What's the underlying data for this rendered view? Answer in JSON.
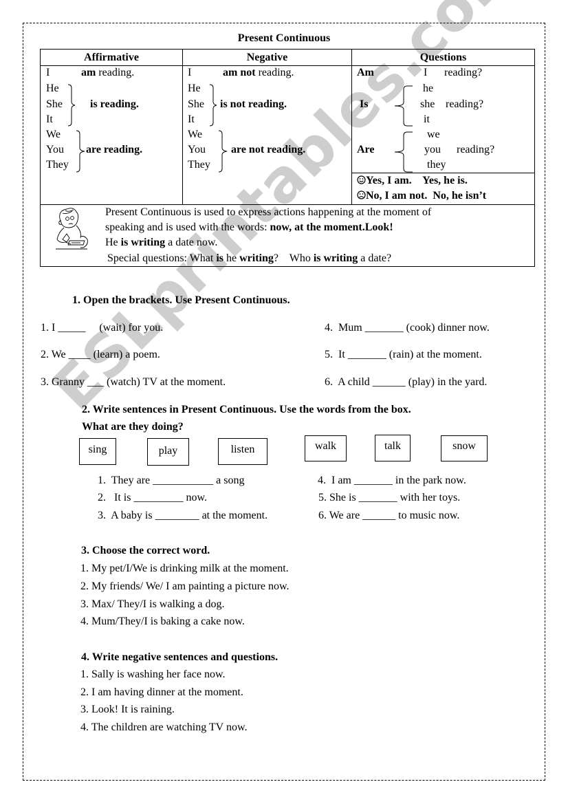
{
  "watermark": "ESLprintables.com",
  "title": "Present Continuous",
  "table": {
    "headers": [
      "Affirmative",
      "Negative",
      "Questions"
    ],
    "affirmative": {
      "row_i": {
        "pronoun": "I",
        "aux": "am",
        "verb": "reading."
      },
      "group_he": {
        "pronouns": [
          "He",
          "She",
          "It"
        ],
        "aux_verb": "is reading."
      },
      "group_we": {
        "pronouns": [
          "We",
          "You",
          "They"
        ],
        "aux_verb": "are reading."
      }
    },
    "negative": {
      "row_i": {
        "pronoun": "I",
        "aux": "am not",
        "verb": "reading."
      },
      "group_he": {
        "pronouns": [
          "He",
          "She",
          "It"
        ],
        "aux_verb": "is not reading."
      },
      "group_we": {
        "pronouns": [
          "We",
          "You",
          "They"
        ],
        "aux_verb": "are not reading."
      }
    },
    "questions": {
      "row_i": {
        "aux": "Am",
        "pronoun": "I",
        "verb": "reading?"
      },
      "group_he": {
        "aux": "Is",
        "pronouns": [
          "he",
          "she",
          "it"
        ],
        "verb": "reading?"
      },
      "group_we": {
        "aux": "Are",
        "pronouns": [
          "we",
          "you",
          "they"
        ],
        "verb": "reading?"
      }
    },
    "answers": {
      "positive_icon": "smiley-happy-icon",
      "positive": "Yes, I am.    Yes, he is.",
      "negative_icon": "smiley-sad-icon",
      "negative": "No, I am not.  No, he isn’t"
    },
    "notes": {
      "illustration": "boy-writing-illustration",
      "line1": "Present Continuous is used to express actions happening at the moment of",
      "line2_plain": "speaking and is used with the words: ",
      "line2_bold": "now, at the moment.Look!",
      "line3": [
        {
          "text": "He ",
          "bold": false
        },
        {
          "text": "is writing",
          "bold": true
        },
        {
          "text": " a date now.",
          "bold": false
        }
      ],
      "line4": [
        {
          "text": "Special questions: What ",
          "bold": false
        },
        {
          "text": "is",
          "bold": true
        },
        {
          "text": " he ",
          "bold": false
        },
        {
          "text": "writing",
          "bold": true
        },
        {
          "text": "?    Who ",
          "bold": false
        },
        {
          "text": "is writing",
          "bold": true
        },
        {
          "text": " a date?",
          "bold": false
        }
      ]
    }
  },
  "exercise1": {
    "heading": "1.  Open the brackets. Use Present Continuous.",
    "items": [
      "1. I _____     (wait) for you.",
      "2. We ____ (learn) a poem.",
      "3. Granny ___ (watch) TV at the moment.",
      "4.  Mum _______ (cook) dinner now.",
      "5.  It _______ (rain) at the moment.",
      "6.  A child ______ (play) in the yard."
    ]
  },
  "exercise2": {
    "heading": "2. Write sentences in Present Continuous. Use the words from the box.",
    "subheading": "What are they doing?",
    "words": [
      "sing",
      "play",
      "listen",
      "walk",
      "talk",
      "snow"
    ],
    "items": [
      "1.  They are ___________ a song",
      "2.   It is _________ now.",
      "3.  A baby is ________ at the moment.",
      "4.  I am _______ in the park now.",
      "5. She is _______ with her toys.",
      "6. We are ______ to music now."
    ]
  },
  "exercise3": {
    "heading": "3. Choose the correct word.",
    "items": [
      "1. My pet/I/We is drinking milk at the moment.",
      "2. My friends/ We/ I am painting a picture now.",
      "3. Max/ They/I is walking a dog.",
      "4. Mum/They/I is baking a cake now."
    ]
  },
  "exercise4": {
    "heading": "4. Write negative sentences and questions.",
    "items": [
      "1. Sally is washing her face now.",
      "2. I am having dinner at the moment.",
      "3. Look! It is raining.",
      "4. The children are watching TV now."
    ]
  }
}
